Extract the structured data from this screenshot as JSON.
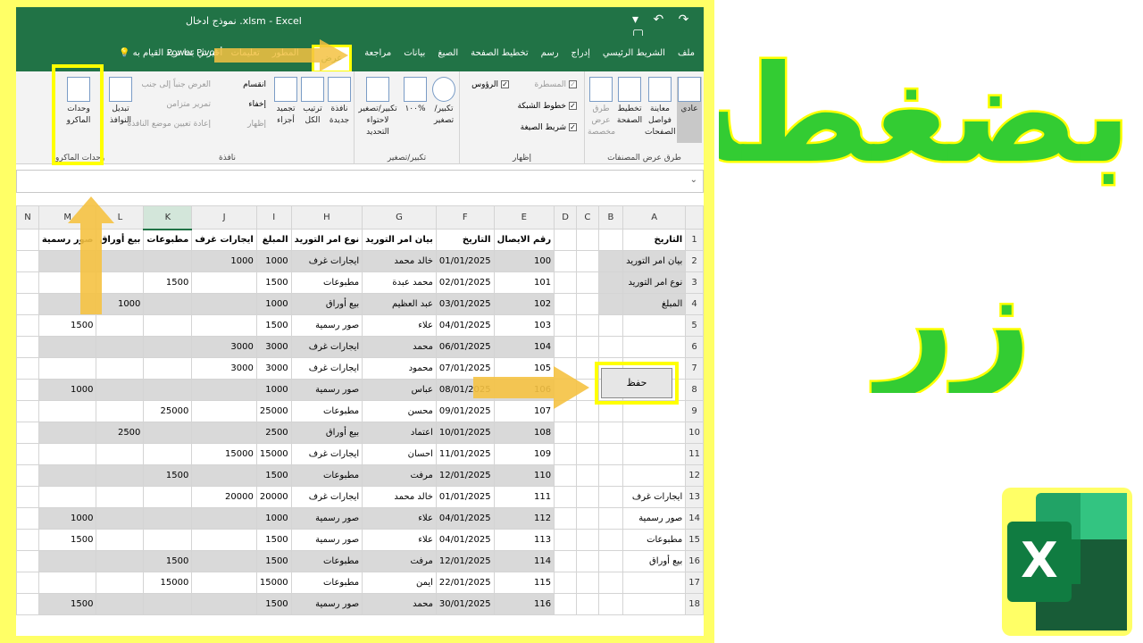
{
  "title_bar": {
    "title": "نموذج ادخال .xlsm  -  Excel",
    "quick_access": "▾  ↶  ↷  ▢"
  },
  "tabs": [
    {
      "label": "ملف",
      "active": false
    },
    {
      "label": "الشريط الرئيسي",
      "active": false
    },
    {
      "label": "إدراج",
      "active": false
    },
    {
      "label": "رسم",
      "active": false
    },
    {
      "label": "تخطيط الصفحة",
      "active": false
    },
    {
      "label": "الصيغ",
      "active": false
    },
    {
      "label": "بيانات",
      "active": false
    },
    {
      "label": "مراجعة",
      "active": false
    },
    {
      "label": "عرض",
      "active": true
    },
    {
      "label": "المطور",
      "active": false
    },
    {
      "label": "تعليمات",
      "active": false
    },
    {
      "label": "Power Pivot",
      "active": false
    }
  ],
  "tell_me": "أخبرني بما تريد القيام به",
  "ribbon": {
    "views": {
      "normal": "عادي",
      "page_break": "معاينة فواصل الصفحات",
      "page_layout": "تخطيط الصفحة",
      "custom": "طرق عرض مخصصة",
      "label": "طرق عرض المصنفات"
    },
    "show": {
      "ruler": "المسطرة",
      "gridlines": "خطوط الشبكة",
      "formula_bar": "شريط الصيغة",
      "headings": "الرؤوس",
      "label": "إظهار"
    },
    "zoom": {
      "zoom": "تكبير/تصغير",
      "hundred": "١٠٠%",
      "selection": "تكبير/تصغير لاحتواء التحديد",
      "label": "تكبير/تصغير"
    },
    "window": {
      "new": "نافذة جديدة",
      "arrange": "ترتيب الكل",
      "freeze": "تجميد أجزاء",
      "split": "انقسام",
      "hide": "إخفاء",
      "unhide": "إظهار",
      "side": "العرض جنباً إلى جنب",
      "sync": "تمرير متزامن",
      "reset": "إعادة تعيين موضع النافذة",
      "switch": "تبديل النوافذ",
      "label": "نافذة"
    },
    "macros": {
      "button": "وحدات الماكرو",
      "label": "وحدات الماكرو"
    }
  },
  "columns": [
    "A",
    "B",
    "C",
    "D",
    "E",
    "F",
    "G",
    "H",
    "I",
    "J",
    "K",
    "L",
    "M",
    "N"
  ],
  "headers_row": {
    "A": "التاريخ",
    "E": "رقم الايصال",
    "F": "التاريخ",
    "G": "بيان امر التوريد",
    "H": "نوع امر التوريد",
    "I": "المبلغ",
    "J": "ايجارات غرف",
    "K": "مطبوعات",
    "L": "بيع أوراق",
    "M": "صور رسمية"
  },
  "labels_a": [
    "بيان امر التوريد",
    "نوع امر التوريد",
    "المبلغ"
  ],
  "rows": [
    {
      "n": "2",
      "E": "100",
      "F": "01/01/2025",
      "G": "خالد محمد",
      "H": "ايجارات غرف",
      "I": "1000",
      "J": "1000",
      "K": "",
      "L": "",
      "M": ""
    },
    {
      "n": "3",
      "E": "101",
      "F": "02/01/2025",
      "G": "محمد عبدة",
      "H": "مطبوعات",
      "I": "1500",
      "J": "",
      "K": "1500",
      "L": "",
      "M": ""
    },
    {
      "n": "4",
      "E": "102",
      "F": "03/01/2025",
      "G": "عبد العظيم",
      "H": "بيع أوراق",
      "I": "1000",
      "J": "",
      "K": "",
      "L": "1000",
      "M": ""
    },
    {
      "n": "5",
      "E": "103",
      "F": "04/01/2025",
      "G": "علاء",
      "H": "صور رسمية",
      "I": "1500",
      "J": "",
      "K": "",
      "L": "",
      "M": "1500"
    },
    {
      "n": "6",
      "E": "104",
      "F": "06/01/2025",
      "G": "محمد",
      "H": "ايجارات غرف",
      "I": "3000",
      "J": "3000",
      "K": "",
      "L": "",
      "M": ""
    },
    {
      "n": "7",
      "E": "105",
      "F": "07/01/2025",
      "G": "محمود",
      "H": "ايجارات غرف",
      "I": "3000",
      "J": "3000",
      "K": "",
      "L": "",
      "M": ""
    },
    {
      "n": "8",
      "E": "106",
      "F": "08/01/2025",
      "G": "عباس",
      "H": "صور رسمية",
      "I": "1000",
      "J": "",
      "K": "",
      "L": "",
      "M": "1000"
    },
    {
      "n": "9",
      "E": "107",
      "F": "09/01/2025",
      "G": "محسن",
      "H": "مطبوعات",
      "I": "25000",
      "J": "",
      "K": "25000",
      "L": "",
      "M": ""
    },
    {
      "n": "10",
      "E": "108",
      "F": "10/01/2025",
      "G": "اعتماد",
      "H": "بيع أوراق",
      "I": "2500",
      "J": "",
      "K": "",
      "L": "2500",
      "M": ""
    },
    {
      "n": "11",
      "E": "109",
      "F": "11/01/2025",
      "G": "احسان",
      "H": "ايجارات غرف",
      "I": "15000",
      "J": "15000",
      "K": "",
      "L": "",
      "M": ""
    },
    {
      "n": "12",
      "E": "110",
      "F": "12/01/2025",
      "G": "مرفت",
      "H": "مطبوعات",
      "I": "1500",
      "J": "",
      "K": "1500",
      "L": "",
      "M": ""
    },
    {
      "n": "13",
      "E": "111",
      "F": "01/01/2025",
      "G": "خالد محمد",
      "H": "ايجارات غرف",
      "I": "20000",
      "J": "20000",
      "K": "",
      "L": "",
      "M": ""
    },
    {
      "n": "14",
      "E": "112",
      "F": "04/01/2025",
      "G": "علاء",
      "H": "صور رسمية",
      "I": "1000",
      "J": "",
      "K": "",
      "L": "",
      "M": "1000"
    },
    {
      "n": "15",
      "E": "113",
      "F": "04/01/2025",
      "G": "علاء",
      "H": "صور رسمية",
      "I": "1500",
      "J": "",
      "K": "",
      "L": "",
      "M": "1500"
    },
    {
      "n": "16",
      "E": "114",
      "F": "12/01/2025",
      "G": "مرفت",
      "H": "مطبوعات",
      "I": "1500",
      "J": "",
      "K": "1500",
      "L": "",
      "M": ""
    },
    {
      "n": "17",
      "E": "115",
      "F": "22/01/2025",
      "G": "ايمن",
      "H": "مطبوعات",
      "I": "15000",
      "J": "",
      "K": "15000",
      "L": "",
      "M": ""
    },
    {
      "n": "18",
      "E": "116",
      "F": "30/01/2025",
      "G": "محمد",
      "H": "صور رسمية",
      "I": "1500",
      "J": "",
      "K": "",
      "L": "",
      "M": "1500"
    }
  ],
  "summary_a": {
    "13": "ايجارات غرف",
    "14": "صور رسمية",
    "15": "مطبوعات",
    "16": "بيع أوراق"
  },
  "save_button": "حفظ",
  "overlay": {
    "line1": "بضغطة",
    "line2": "زر"
  },
  "colors": {
    "excel_green": "#217346",
    "highlight": "#ffff00",
    "arrow": "#f5c242",
    "overlay_text": "#33cc33"
  }
}
